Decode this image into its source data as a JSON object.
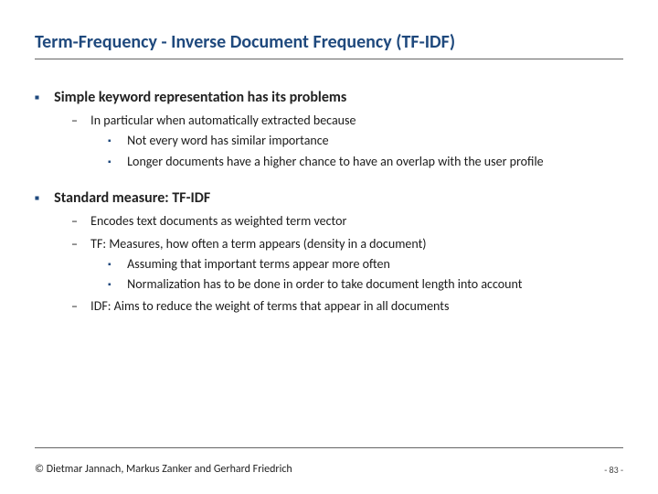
{
  "title": "Term-Frequency - Inverse Document Frequency (TF-IDF)",
  "sections": [
    {
      "heading": "Simple keyword representation has its problems",
      "items": [
        {
          "text": "In particular when automatically extracted because",
          "sub": [
            "Not every word has similar importance",
            "Longer documents have a higher chance to have an overlap with the user profile"
          ]
        }
      ]
    },
    {
      "heading": "Standard measure: TF-IDF",
      "items": [
        {
          "text": "Encodes text documents as weighted term vector",
          "sub": []
        },
        {
          "text": "TF: Measures, how often a term appears (density in a document)",
          "sub": [
            "Assuming that important terms appear more often",
            "Normalization has to be done in order to take document length into account"
          ]
        },
        {
          "text": "IDF: Aims to reduce the weight of terms that appear in all documents",
          "sub": []
        }
      ]
    }
  ],
  "footer": {
    "copyright": "© Dietmar Jannach, Markus Zanker and Gerhard Friedrich",
    "page": "- 83 -"
  }
}
